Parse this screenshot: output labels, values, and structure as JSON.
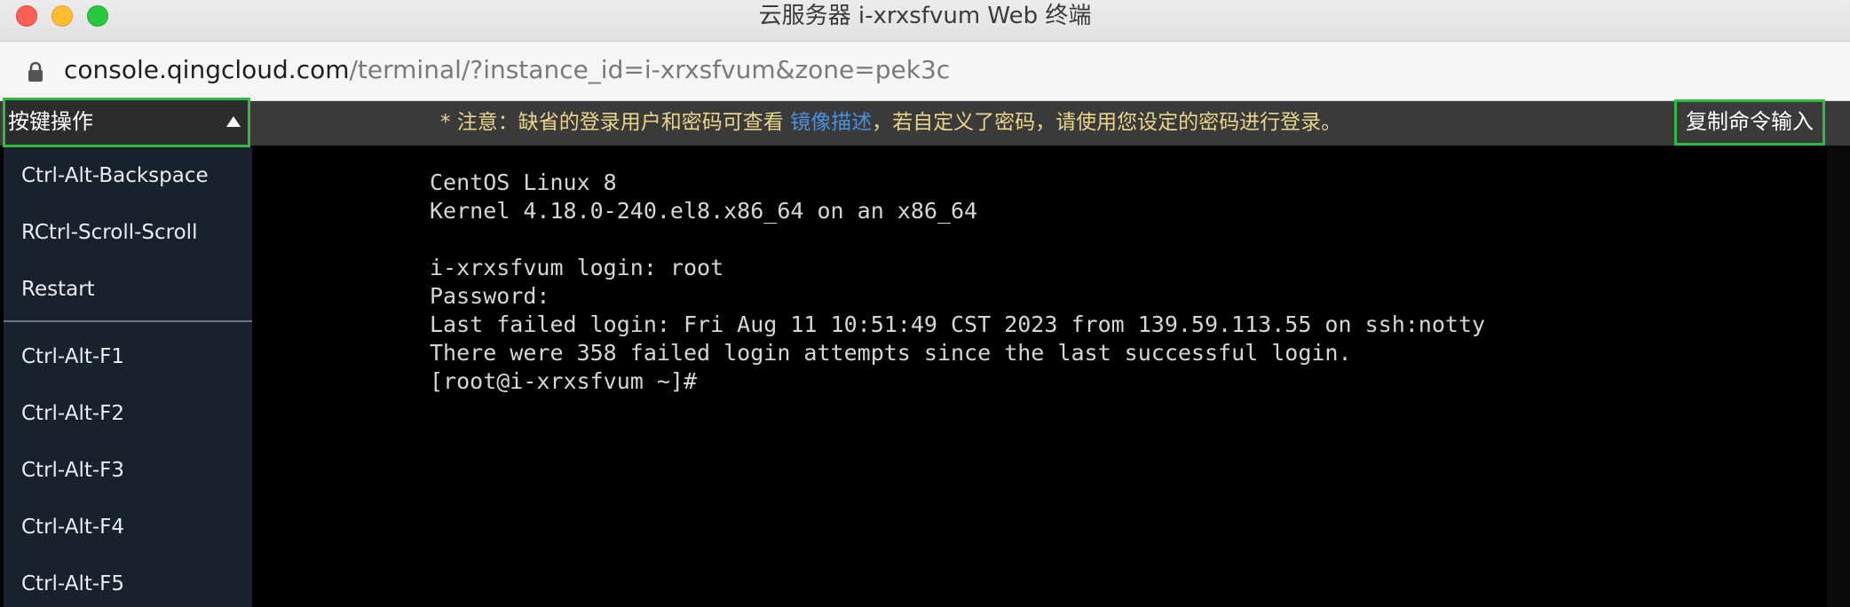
{
  "window": {
    "title": "云服务器 i-xrxsfvum Web 终端"
  },
  "address_bar": {
    "host": "console.qingcloud.com",
    "path": "/terminal/?instance_id=i-xrxsfvum&zone=pek3c"
  },
  "toolbar": {
    "notice_prefix": "* 注意：缺省的登录用户和密码可查看 ",
    "notice_link": "镜像描述",
    "notice_suffix": "，若自定义了密码，请使用您设定的密码进行登录。",
    "copy_button": "复制命令输入",
    "accent_color": "#2ebc3e",
    "link_color": "#4a8fe0"
  },
  "key_menu": {
    "label": "按键操作",
    "group1": [
      "Ctrl-Alt-Backspace",
      "RCtrl-Scroll-Scroll",
      "Restart"
    ],
    "group2": [
      "Ctrl-Alt-F1",
      "Ctrl-Alt-F2",
      "Ctrl-Alt-F3",
      "Ctrl-Alt-F4",
      "Ctrl-Alt-F5"
    ]
  },
  "terminal": {
    "lines": [
      "CentOS Linux 8",
      "Kernel 4.18.0-240.el8.x86_64 on an x86_64",
      "",
      "i-xrxsfvum login: root",
      "Password:",
      "Last failed login: Fri Aug 11 10:51:49 CST 2023 from 139.59.113.55 on ssh:notty",
      "There were 358 failed login attempts since the last successful login.",
      "[root@i-xrxsfvum ~]#"
    ]
  }
}
